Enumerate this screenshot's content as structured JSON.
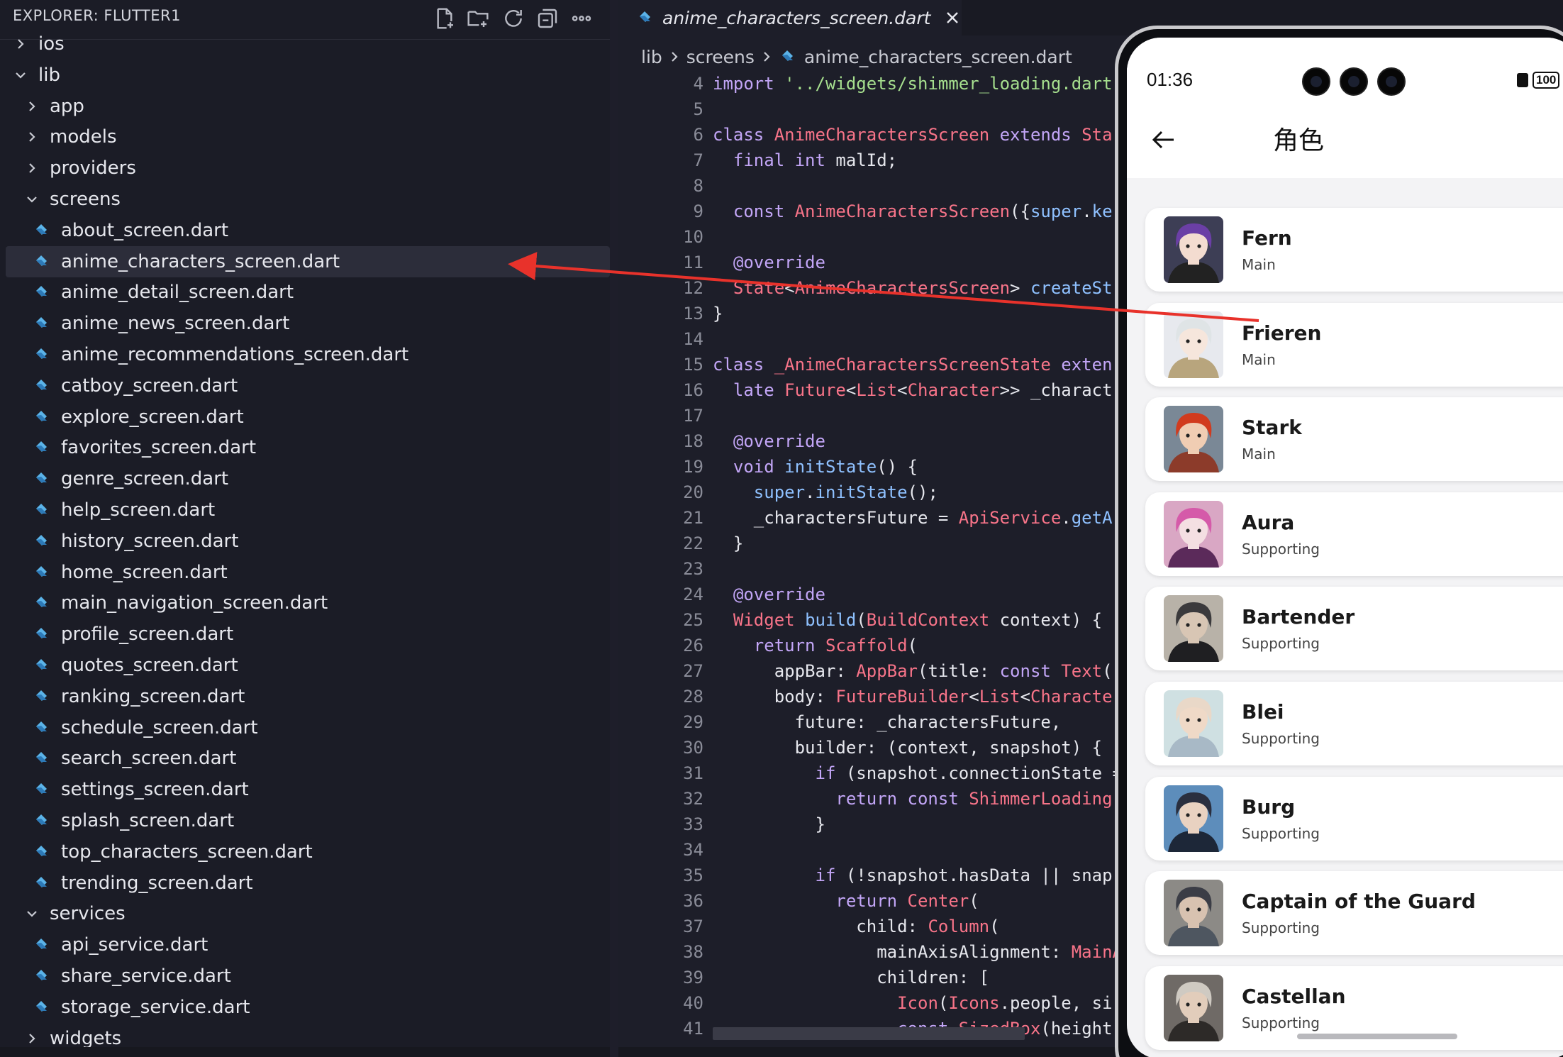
{
  "explorer": {
    "title": "EXPLORER: FLUTTER1",
    "actions": [
      "new-file-icon",
      "new-folder-icon",
      "refresh-icon",
      "collapse-all-icon",
      "more-icon"
    ],
    "rows": [
      {
        "type": "folder",
        "label": "ios",
        "open": false,
        "depth": 0
      },
      {
        "type": "folder",
        "label": "lib",
        "open": true,
        "depth": 0
      },
      {
        "type": "folder",
        "label": "app",
        "open": false,
        "depth": 1
      },
      {
        "type": "folder",
        "label": "models",
        "open": false,
        "depth": 1
      },
      {
        "type": "folder",
        "label": "providers",
        "open": false,
        "depth": 1
      },
      {
        "type": "folder",
        "label": "screens",
        "open": true,
        "depth": 1
      },
      {
        "type": "file",
        "label": "about_screen.dart",
        "depth": 2
      },
      {
        "type": "file",
        "label": "anime_characters_screen.dart",
        "depth": 2,
        "selected": true
      },
      {
        "type": "file",
        "label": "anime_detail_screen.dart",
        "depth": 2
      },
      {
        "type": "file",
        "label": "anime_news_screen.dart",
        "depth": 2
      },
      {
        "type": "file",
        "label": "anime_recommendations_screen.dart",
        "depth": 2
      },
      {
        "type": "file",
        "label": "catboy_screen.dart",
        "depth": 2
      },
      {
        "type": "file",
        "label": "explore_screen.dart",
        "depth": 2
      },
      {
        "type": "file",
        "label": "favorites_screen.dart",
        "depth": 2
      },
      {
        "type": "file",
        "label": "genre_screen.dart",
        "depth": 2
      },
      {
        "type": "file",
        "label": "help_screen.dart",
        "depth": 2
      },
      {
        "type": "file",
        "label": "history_screen.dart",
        "depth": 2
      },
      {
        "type": "file",
        "label": "home_screen.dart",
        "depth": 2
      },
      {
        "type": "file",
        "label": "main_navigation_screen.dart",
        "depth": 2
      },
      {
        "type": "file",
        "label": "profile_screen.dart",
        "depth": 2
      },
      {
        "type": "file",
        "label": "quotes_screen.dart",
        "depth": 2
      },
      {
        "type": "file",
        "label": "ranking_screen.dart",
        "depth": 2
      },
      {
        "type": "file",
        "label": "schedule_screen.dart",
        "depth": 2
      },
      {
        "type": "file",
        "label": "search_screen.dart",
        "depth": 2
      },
      {
        "type": "file",
        "label": "settings_screen.dart",
        "depth": 2
      },
      {
        "type": "file",
        "label": "splash_screen.dart",
        "depth": 2
      },
      {
        "type": "file",
        "label": "top_characters_screen.dart",
        "depth": 2
      },
      {
        "type": "file",
        "label": "trending_screen.dart",
        "depth": 2
      },
      {
        "type": "folder",
        "label": "services",
        "open": true,
        "depth": 1
      },
      {
        "type": "file",
        "label": "api_service.dart",
        "depth": 2
      },
      {
        "type": "file",
        "label": "share_service.dart",
        "depth": 2
      },
      {
        "type": "file",
        "label": "storage_service.dart",
        "depth": 2
      },
      {
        "type": "folder",
        "label": "widgets",
        "open": false,
        "depth": 1
      }
    ]
  },
  "editor": {
    "tab": {
      "label": "anime_characters_screen.dart",
      "close_icon": "close-icon"
    },
    "breadcrumb": [
      "lib",
      "screens",
      "anime_characters_screen.dart"
    ],
    "first_line": 4,
    "lines": [
      [
        [
          "kw",
          "import "
        ],
        [
          "str",
          "'../widgets/shimmer_loading.dart"
        ]
      ],
      [],
      [
        [
          "kw",
          "class "
        ],
        [
          "ty",
          "AnimeCharactersScreen "
        ],
        [
          "kw",
          "extends "
        ],
        [
          "ty",
          "Sta"
        ]
      ],
      [
        [
          "pl",
          "  "
        ],
        [
          "kw",
          "final int "
        ],
        [
          "pl",
          "malId;"
        ]
      ],
      [],
      [
        [
          "pl",
          "  "
        ],
        [
          "kw",
          "const "
        ],
        [
          "ty",
          "AnimeCharactersScreen"
        ],
        [
          "pl",
          "({"
        ],
        [
          "fn",
          "super"
        ],
        [
          "pl",
          "."
        ],
        [
          "fn",
          "ke"
        ]
      ],
      [],
      [
        [
          "pl",
          "  "
        ],
        [
          "an",
          "@override"
        ]
      ],
      [
        [
          "pl",
          "  "
        ],
        [
          "ty",
          "State"
        ],
        [
          "pl",
          "<"
        ],
        [
          "ty",
          "AnimeCharactersScreen"
        ],
        [
          "pl",
          "> "
        ],
        [
          "fn",
          "createSt"
        ]
      ],
      [
        [
          "pl",
          "}"
        ]
      ],
      [],
      [
        [
          "kw",
          "class "
        ],
        [
          "ty",
          "_AnimeCharactersScreenState "
        ],
        [
          "kw",
          "exten"
        ]
      ],
      [
        [
          "pl",
          "  "
        ],
        [
          "kw",
          "late "
        ],
        [
          "ty",
          "Future"
        ],
        [
          "pl",
          "<"
        ],
        [
          "ty",
          "List"
        ],
        [
          "pl",
          "<"
        ],
        [
          "ty",
          "Character"
        ],
        [
          "pl",
          ">> _charact"
        ]
      ],
      [],
      [
        [
          "pl",
          "  "
        ],
        [
          "an",
          "@override"
        ]
      ],
      [
        [
          "pl",
          "  "
        ],
        [
          "kw",
          "void "
        ],
        [
          "fn",
          "initState"
        ],
        [
          "pl",
          "() {"
        ]
      ],
      [
        [
          "pl",
          "    "
        ],
        [
          "fn",
          "super"
        ],
        [
          "pl",
          "."
        ],
        [
          "fn",
          "initState"
        ],
        [
          "pl",
          "();"
        ]
      ],
      [
        [
          "pl",
          "    _charactersFuture = "
        ],
        [
          "ty",
          "ApiService"
        ],
        [
          "pl",
          "."
        ],
        [
          "fn",
          "getA"
        ]
      ],
      [
        [
          "pl",
          "  }"
        ]
      ],
      [],
      [
        [
          "pl",
          "  "
        ],
        [
          "an",
          "@override"
        ]
      ],
      [
        [
          "pl",
          "  "
        ],
        [
          "ty",
          "Widget "
        ],
        [
          "fn",
          "build"
        ],
        [
          "pl",
          "("
        ],
        [
          "ty",
          "BuildContext "
        ],
        [
          "pl",
          "context) {"
        ]
      ],
      [
        [
          "pl",
          "    "
        ],
        [
          "kw",
          "return "
        ],
        [
          "ty",
          "Scaffold"
        ],
        [
          "pl",
          "("
        ]
      ],
      [
        [
          "pl",
          "      appBar: "
        ],
        [
          "ty",
          "AppBar"
        ],
        [
          "pl",
          "(title: "
        ],
        [
          "kw",
          "const "
        ],
        [
          "ty",
          "Text"
        ],
        [
          "pl",
          "("
        ]
      ],
      [
        [
          "pl",
          "      body: "
        ],
        [
          "ty",
          "FutureBuilder"
        ],
        [
          "pl",
          "<"
        ],
        [
          "ty",
          "List"
        ],
        [
          "pl",
          "<"
        ],
        [
          "ty",
          "Characte"
        ]
      ],
      [
        [
          "pl",
          "        future: _charactersFuture,"
        ]
      ],
      [
        [
          "pl",
          "        builder: (context, snapshot) {"
        ]
      ],
      [
        [
          "pl",
          "          "
        ],
        [
          "kw",
          "if "
        ],
        [
          "pl",
          "(snapshot.connectionState ="
        ]
      ],
      [
        [
          "pl",
          "            "
        ],
        [
          "kw",
          "return const "
        ],
        [
          "ty",
          "ShimmerLoading"
        ]
      ],
      [
        [
          "pl",
          "          }"
        ]
      ],
      [],
      [
        [
          "pl",
          "          "
        ],
        [
          "kw",
          "if "
        ],
        [
          "pl",
          "(!snapshot.hasData || snap"
        ]
      ],
      [
        [
          "pl",
          "            "
        ],
        [
          "kw",
          "return "
        ],
        [
          "ty",
          "Center"
        ],
        [
          "pl",
          "("
        ]
      ],
      [
        [
          "pl",
          "              child: "
        ],
        [
          "ty",
          "Column"
        ],
        [
          "pl",
          "("
        ]
      ],
      [
        [
          "pl",
          "                mainAxisAlignment: "
        ],
        [
          "ty",
          "MainA"
        ]
      ],
      [
        [
          "pl",
          "                children: ["
        ]
      ],
      [
        [
          "pl",
          "                  "
        ],
        [
          "ty",
          "Icon"
        ],
        [
          "pl",
          "("
        ],
        [
          "ty",
          "Icons"
        ],
        [
          "pl",
          ".people, si"
        ]
      ],
      [
        [
          "pl",
          "                  "
        ],
        [
          "kw",
          "const "
        ],
        [
          "ty",
          "SizedBox"
        ],
        [
          "pl",
          "(height:"
        ]
      ]
    ]
  },
  "phone": {
    "time": "01:36",
    "battery": "100",
    "back_icon": "arrow-left-icon",
    "title": "角色",
    "characters": [
      {
        "name": "Fern",
        "role": "Main",
        "colors": {
          "bg": "#3d3e55",
          "hair": "#6b3fa6",
          "skin": "#f3dcd0",
          "cloth": "#222"
        }
      },
      {
        "name": "Frieren",
        "role": "Main",
        "colors": {
          "bg": "#e7e9ee",
          "hair": "#dfe4e6",
          "skin": "#f6e6dc",
          "cloth": "#b8a57d"
        }
      },
      {
        "name": "Stark",
        "role": "Main",
        "colors": {
          "bg": "#7a8896",
          "hair": "#d13b1e",
          "skin": "#f0cdb3",
          "cloth": "#8c3b2a"
        }
      },
      {
        "name": "Aura",
        "role": "Supporting",
        "colors": {
          "bg": "#d9a7c4",
          "hair": "#d55aa9",
          "skin": "#f4dfe2",
          "cloth": "#5b2a5a"
        }
      },
      {
        "name": "Bartender",
        "role": "Supporting",
        "colors": {
          "bg": "#b8b2a8",
          "hair": "#3b3a3c",
          "skin": "#d8c6b4",
          "cloth": "#1f1f22"
        }
      },
      {
        "name": "Blei",
        "role": "Supporting",
        "colors": {
          "bg": "#cfe0e2",
          "hair": "#e9d8c8",
          "skin": "#efd9c7",
          "cloth": "#a8b9c6"
        }
      },
      {
        "name": "Burg",
        "role": "Supporting",
        "colors": {
          "bg": "#5d8dbb",
          "hair": "#2a2f3f",
          "skin": "#e9d2c1",
          "cloth": "#1d2738"
        }
      },
      {
        "name": "Captain of the Guard",
        "role": "Supporting",
        "colors": {
          "bg": "#8c8a86",
          "hair": "#3b3d46",
          "skin": "#d8c2b0",
          "cloth": "#4e5660"
        }
      },
      {
        "name": "Castellan",
        "role": "Supporting",
        "colors": {
          "bg": "#6f6a66",
          "hair": "#cfcac2",
          "skin": "#e2cdbb",
          "cloth": "#2d2a28"
        }
      }
    ]
  },
  "colors": {
    "accent_arrow": "#e8322b",
    "dart_icon": "#5bb3e8"
  }
}
